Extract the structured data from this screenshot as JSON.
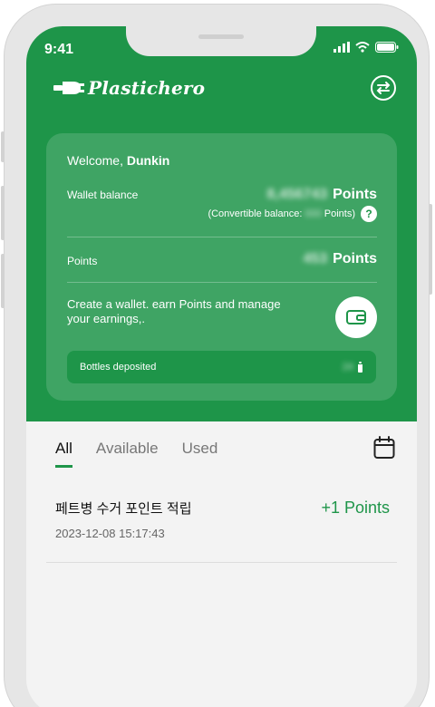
{
  "status_bar": {
    "time": "9:41"
  },
  "header": {
    "brand": "Plastichero"
  },
  "card": {
    "welcome_prefix": "Welcome,",
    "user_name": "Dunkin",
    "wallet_label": "Wallet balance",
    "wallet_value": "8,456743",
    "points_unit": "Points",
    "convertible_prefix": "(Convertible balance:",
    "convertible_value": "000",
    "convertible_suffix": "Points)",
    "help_glyph": "?",
    "points_label": "Points",
    "points_value": "453",
    "promo_text": "Create a wallet. earn Points and manage your earnings,.",
    "bottles_label": "Bottles deposited",
    "bottles_value": "24"
  },
  "tabs": [
    {
      "label": "All",
      "active": true
    },
    {
      "label": "Available",
      "active": false
    },
    {
      "label": "Used",
      "active": false
    }
  ],
  "history": [
    {
      "title": "페트병 수거 포인트 적립",
      "date": "2023-12-08 15:17:43",
      "points": "+1 Points"
    }
  ],
  "colors": {
    "brand_green": "#1e9549",
    "background": "#f3f3f3"
  }
}
